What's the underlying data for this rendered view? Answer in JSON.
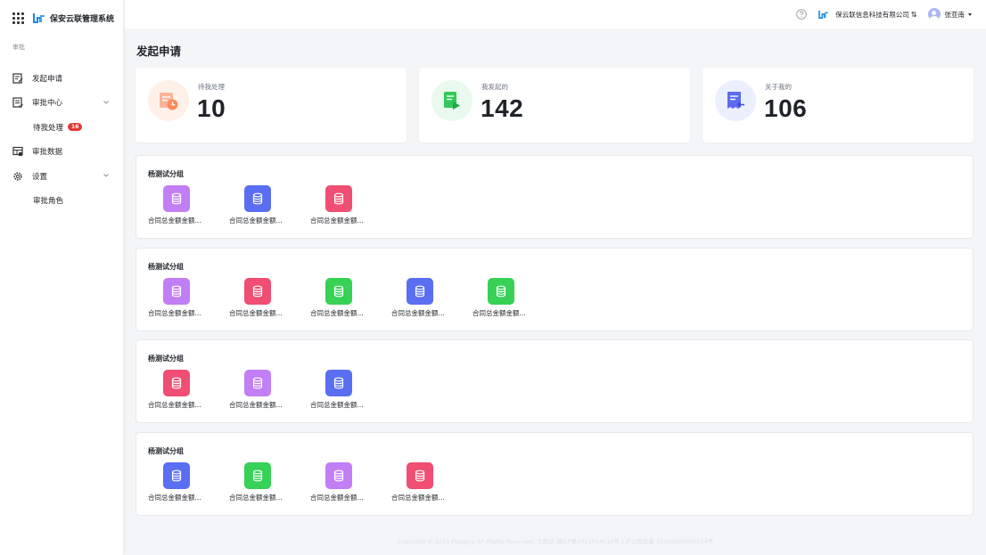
{
  "app": {
    "title": "保安云联管理系统"
  },
  "sidebar": {
    "section": "审批",
    "items": [
      {
        "label": "发起申请",
        "icon": "form-edit-icon"
      },
      {
        "label": "审批中心",
        "icon": "list-check-icon",
        "expandable": true
      },
      {
        "label": "待我处理",
        "badge": "16",
        "sub": true
      },
      {
        "label": "审批数据",
        "icon": "table-data-icon"
      },
      {
        "label": "设置",
        "icon": "gear-icon",
        "expandable": true
      },
      {
        "label": "审批角色",
        "sub": true
      }
    ]
  },
  "topbar": {
    "company": "保云联信息科技有限公司",
    "swap": "⇅",
    "user": "张亚南"
  },
  "page": {
    "title": "发起申请"
  },
  "stats": [
    {
      "label": "待我处理",
      "value": "10",
      "color": "#fa8c5a",
      "bg": "#fff1ea"
    },
    {
      "label": "我发起的",
      "value": "142",
      "color": "#34c759",
      "bg": "#e9f9ee"
    },
    {
      "label": "关于我的",
      "value": "106",
      "color": "#5b6cf0",
      "bg": "#eceffe"
    }
  ],
  "colors": {
    "purple": "#c27ef5",
    "blue": "#5a6ef2",
    "red": "#f04e72",
    "green": "#36d155"
  },
  "groups": [
    {
      "title": "杨测试分组",
      "apps": [
        {
          "label": "合同总金额金额...",
          "color": "purple"
        },
        {
          "label": "合同总金额金额...",
          "color": "blue"
        },
        {
          "label": "合同总金额金额...",
          "color": "red"
        }
      ]
    },
    {
      "title": "杨测试分组",
      "apps": [
        {
          "label": "合同总金额金额...",
          "color": "purple"
        },
        {
          "label": "合同总金额金额...",
          "color": "red"
        },
        {
          "label": "合同总金额金额...",
          "color": "green"
        },
        {
          "label": "合同总金额金额...",
          "color": "blue"
        },
        {
          "label": "合同总金额金额...",
          "color": "green"
        }
      ]
    },
    {
      "title": "杨测试分组",
      "apps": [
        {
          "label": "合同总金额金额...",
          "color": "red"
        },
        {
          "label": "合同总金额金额...",
          "color": "purple"
        },
        {
          "label": "合同总金额金额...",
          "color": "blue"
        }
      ]
    },
    {
      "title": "杨测试分组",
      "apps": [
        {
          "label": "合同总金额金额...",
          "color": "blue"
        },
        {
          "label": "合同总金额金额...",
          "color": "green"
        },
        {
          "label": "合同总金额金额...",
          "color": "purple"
        },
        {
          "label": "合同总金额金额...",
          "color": "red"
        }
      ]
    }
  ],
  "footer": "Copyright © 2021 Fengjuy. All Rights Reserved. 大数达 湘ICP备2021014510号 | 沪公网安备 31010602005514号"
}
